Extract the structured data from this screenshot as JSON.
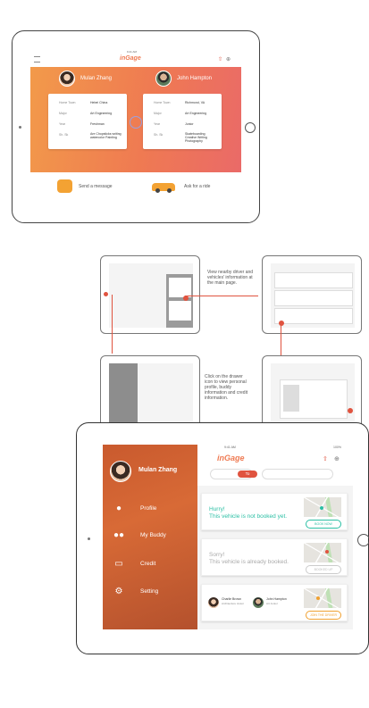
{
  "top_screen": {
    "status_time": "9:41 AM",
    "logo": "inGage",
    "left_user": {
      "name": "Mulan Zhang",
      "fields": [
        {
          "k": "Home Town",
          "v": "Hebei China"
        },
        {
          "k": "Major",
          "v": "Art Engineering"
        },
        {
          "k": "Year",
          "v": "Freshman"
        },
        {
          "k": "Sh. Sk",
          "v": "Are Chopsticks writing watercolor Painting"
        }
      ]
    },
    "right_user": {
      "name": "John Hampton",
      "fields": [
        {
          "k": "Home Town",
          "v": "Richmond, VA"
        },
        {
          "k": "Major",
          "v": "Art Engineering"
        },
        {
          "k": "Year",
          "v": "Junior"
        },
        {
          "k": "Sh. Sk",
          "v": "Skateboarding Creative Writing Photography"
        }
      ]
    },
    "send_message": "Send a message",
    "ask_ride": "Ask for a ride"
  },
  "flow_notes": {
    "note1": "View nearby driver and vehicles' information at the main page.",
    "note2": "Click on the drawer icon to view personal profile, buddy information and credit information."
  },
  "bottom_screen": {
    "status_time": "9:41 AM",
    "status_right": "100%",
    "logo": "inGage",
    "to_label": "To",
    "user_name": "Mulan Zhang",
    "menu": [
      {
        "label": "Profile",
        "icon": "person-icon"
      },
      {
        "label": "My Buddy",
        "icon": "buddy-icon"
      },
      {
        "label": "Credit",
        "icon": "credit-card-icon"
      },
      {
        "label": "Setting",
        "icon": "gear-icon"
      }
    ],
    "card1": {
      "title": "Hurry!",
      "subtitle": "This vehicle is not booked yet.",
      "button": "BOOK NOW"
    },
    "card2": {
      "title": "Sorry!",
      "subtitle": "This vehicle is already booked.",
      "button": "BOOKED UP"
    },
    "card3": {
      "person1": {
        "name": "Charlie Brown",
        "detail": "Architecture Junior"
      },
      "person2": {
        "name": "John Hampton",
        "detail": "Art Junior"
      },
      "button": "JOIN THE DRIVER"
    }
  },
  "colors": {
    "accent": "#ef7a52",
    "teal": "#2bbfa4",
    "orange": "#f0a030"
  }
}
